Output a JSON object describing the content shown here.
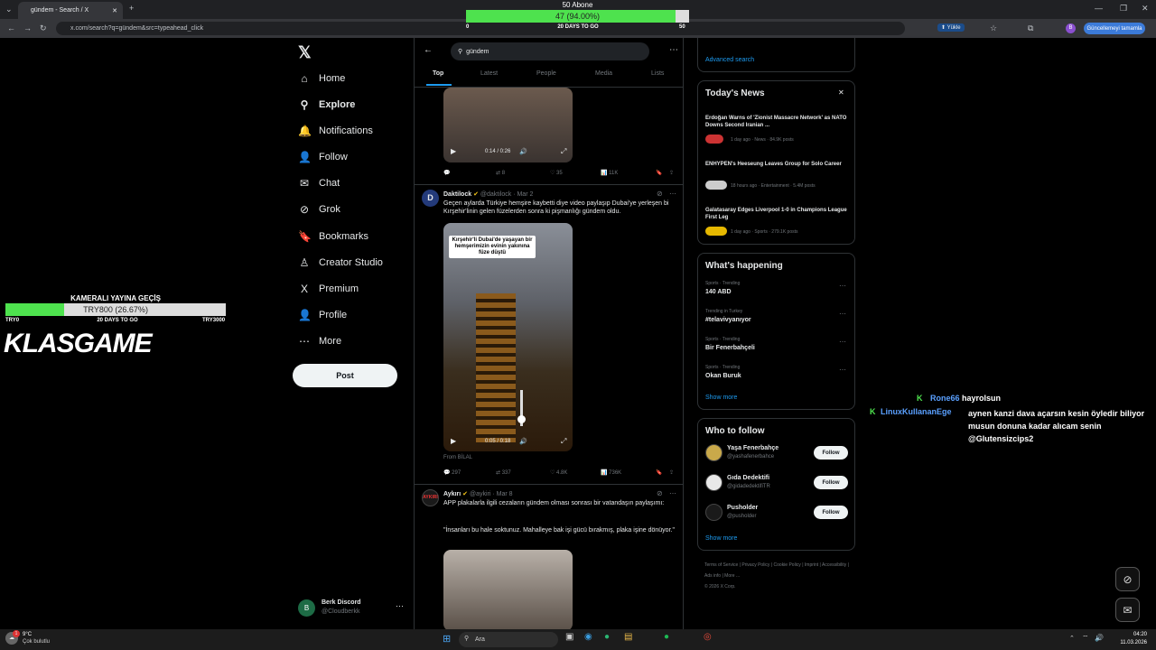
{
  "browser": {
    "tab_title": "gündem - Search / X",
    "url": "x.com/search?q=gündem&src=typeahead_click",
    "upload_label": "Yükle",
    "update_label": "Güncellemeyi tamamla",
    "profile_initial": "B"
  },
  "overlay_sub": {
    "title": "50 Abone",
    "label": "47 (94.00%)",
    "progress": 0.94,
    "min": "0",
    "max": "50",
    "caption": "20 DAYS TO GO"
  },
  "overlay_cam": {
    "title": "KAMERALI YAYINA GEÇİŞ",
    "label": "TRY800 (26.67%)",
    "progress": 0.2667,
    "min": "TRY0",
    "max": "TRY3000",
    "caption": "20 DAYS TO GO",
    "logo": "KLASGAME"
  },
  "nav": [
    {
      "label": "Home",
      "icon": "⌂"
    },
    {
      "label": "Explore",
      "icon": "⚲"
    },
    {
      "label": "Notifications",
      "icon": "🔔"
    },
    {
      "label": "Follow",
      "icon": "👤"
    },
    {
      "label": "Chat",
      "icon": "✉"
    },
    {
      "label": "Grok",
      "icon": "⊘"
    },
    {
      "label": "Bookmarks",
      "icon": "🔖"
    },
    {
      "label": "Creator Studio",
      "icon": "♙"
    },
    {
      "label": "Premium",
      "icon": "X"
    },
    {
      "label": "Profile",
      "icon": "👤"
    },
    {
      "label": "More",
      "icon": "⋯"
    }
  ],
  "post_label": "Post",
  "account": {
    "name": "Berk Discord",
    "handle": "@Cloudberkk",
    "initial": "B"
  },
  "search": {
    "query": "gündem"
  },
  "tabs": [
    "Top",
    "Latest",
    "People",
    "Media",
    "Lists"
  ],
  "tweet0": {
    "time": "0:14 / 0:26",
    "replies": "",
    "retweets": "8",
    "likes": "35",
    "views": "11K"
  },
  "tweet1": {
    "name": "Daktilock",
    "handle": "@daktilock · Mar 2",
    "text": "Geçen aylarda Türkiye hemşire kaybetti diye video paylaşıp Dubai'ye yerleşen bi Kırşehir'linin gelen füzelerden sonra ki pişmanlığı gündem oldu.",
    "caption": "Kırşehir'li Dubai'de yaşayan bir hemşerimizin evinin yakınına füze düştü",
    "time": "0:05 / 0:18",
    "from": "From BİLAL",
    "replies": "297",
    "retweets": "337",
    "likes": "4.8K",
    "views": "736K"
  },
  "tweet2": {
    "name": "Aykırı",
    "handle": "@aykiri · Mar 8",
    "text1": "APP plakalarla ilgili cezaların gündem olması sonrası bir vatandaşın paylaşımı:",
    "text2": "\"İnsanları bu hale soktunuz. Mahalleye bak işi gücü bırakmış, plaka işine dönüyor.\""
  },
  "advanced_search": "Advanced search",
  "todays_news": {
    "title": "Today's News",
    "items": [
      {
        "headline": "Erdoğan Warns of 'Zionist Massacre Network' as NATO Downs Second Iranian ...",
        "meta": "1 day ago · News · 84.9K posts"
      },
      {
        "headline": "ENHYPEN's Heeseung Leaves Group for Solo Career",
        "meta": "18 hours ago · Entertainment · 5.4M posts"
      },
      {
        "headline": "Galatasaray Edges Liverpool 1-0 in Champions League First Leg",
        "meta": "1 day ago · Sports · 279.1K posts"
      }
    ]
  },
  "happening": {
    "title": "What's happening",
    "items": [
      {
        "context": "Sports · Trending",
        "topic": "140 ABD"
      },
      {
        "context": "Trending in Turkey",
        "topic": "#telavivyanıyor"
      },
      {
        "context": "Sports · Trending",
        "topic": "Bir Fenerbahçeli"
      },
      {
        "context": "Sports · Trending",
        "topic": "Okan Buruk"
      }
    ],
    "show_more": "Show more"
  },
  "who_to_follow": {
    "title": "Who to follow",
    "items": [
      {
        "name": "Yaşa Fenerbahçe",
        "handle": "@yashafenerbahce"
      },
      {
        "name": "Gıda Dedektifi",
        "handle": "@gidadedektifiTR"
      },
      {
        "name": "Pusholder",
        "handle": "@pusholder"
      }
    ],
    "follow_label": "Follow",
    "show_more": "Show more"
  },
  "footer_links": [
    "Terms of Service",
    "Privacy Policy",
    "Cookie Policy",
    "Imprint",
    "Accessibility",
    "Ads info",
    "More ...",
    "© 2026 X Corp."
  ],
  "chat": [
    {
      "user": "Rone66",
      "message": "hayrolsun"
    },
    {
      "user": "LinuxKullananEge",
      "message": "aynen kanzi dava açarsın kesin öyledir biliyor musun donuna kadar alıcam senin @Glutensizcips2"
    }
  ],
  "taskbar": {
    "weather_temp": "9°C",
    "weather_desc": "Çok bulutlu",
    "search": "Ara",
    "time": "04:20",
    "date": "11.03.2026",
    "notif": "1"
  }
}
